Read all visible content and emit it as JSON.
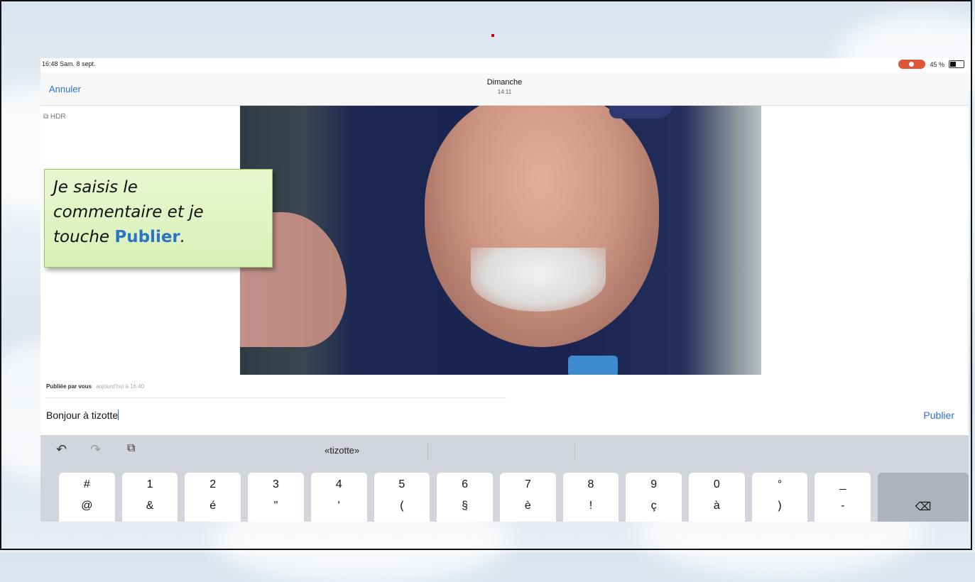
{
  "status_bar": {
    "time_date": "16:48  Sam. 8 sept.",
    "battery": "45 %"
  },
  "nav": {
    "cancel_label": "Annuler",
    "title": "Dimanche",
    "subtitle": "14:11"
  },
  "photo": {
    "hdr_label": "HDR"
  },
  "callout": {
    "line1": "Je saisis le",
    "line2": "commentaire et je",
    "line3_prefix": "touche ",
    "line3_highlight": "Publier",
    "line3_suffix": "."
  },
  "post": {
    "published_by": "Publiée par vous",
    "published_when": "aujourd'hui à 16:40"
  },
  "comment": {
    "value": "Bonjour à tizotte",
    "publish_label": "Publier"
  },
  "keyboard": {
    "suggestion": "«tizotte»",
    "keys": [
      {
        "top": "#",
        "bottom": "@"
      },
      {
        "top": "1",
        "bottom": "&"
      },
      {
        "top": "2",
        "bottom": "é"
      },
      {
        "top": "3",
        "bottom": "\""
      },
      {
        "top": "4",
        "bottom": "'"
      },
      {
        "top": "5",
        "bottom": "("
      },
      {
        "top": "6",
        "bottom": "§"
      },
      {
        "top": "7",
        "bottom": "è"
      },
      {
        "top": "8",
        "bottom": "!"
      },
      {
        "top": "9",
        "bottom": "ç"
      },
      {
        "top": "0",
        "bottom": "à"
      },
      {
        "top": "°",
        "bottom": ")"
      },
      {
        "top": "_",
        "bottom": "-"
      }
    ],
    "delete_glyph": "⌫"
  },
  "colors": {
    "accent": "#2a73c6",
    "callout_bg": "#e3f4c6"
  }
}
